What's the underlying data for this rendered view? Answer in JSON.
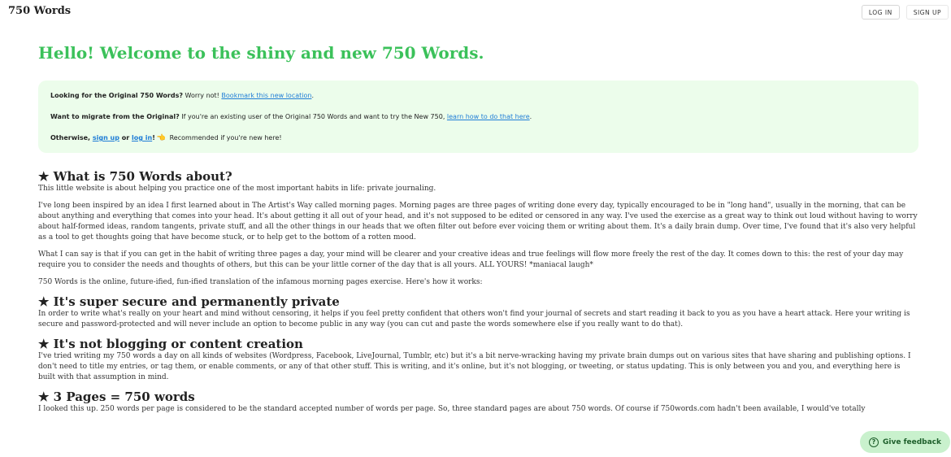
{
  "header": {
    "brand": "750 Words",
    "login_label": "LOG IN",
    "signup_label": "SIGN UP"
  },
  "hero": {
    "title": "Hello! Welcome to the shiny and new 750 Words."
  },
  "notice": {
    "line1_bold": "Looking for the Original 750 Words?",
    "line1_text": " Worry not! ",
    "line1_link": "Bookmark this new location",
    "line1_end": ".",
    "line2_bold": "Want to migrate from the Original?",
    "line2_text": " If you're an existing user of the Original 750 Words and want to try the New 750, ",
    "line2_link": "learn how to do that here",
    "line2_end": ".",
    "line3_bold_a": "Otherwise, ",
    "line3_link_signup": "sign up",
    "line3_bold_or": " or ",
    "line3_link_login": "log in",
    "line3_bang": "!",
    "line3_hand": "👈",
    "line3_text": " Recommended if you're new here!"
  },
  "sections": {
    "about_title": "★ What is 750 Words about?",
    "about_p1": "This little website is about helping you practice one of the most important habits in life: private journaling.",
    "about_p2": "I've long been inspired by an idea I first learned about in The Artist's Way called morning pages. Morning pages are three pages of writing done every day, typically encouraged to be in \"long hand\", usually in the morning, that can be about anything and everything that comes into your head. It's about getting it all out of your head, and it's not supposed to be edited or censored in any way. I've used the exercise as a great way to think out loud without having to worry about half-formed ideas, random tangents, private stuff, and all the other things in our heads that we often filter out before ever voicing them or writing about them. It's a daily brain dump. Over time, I've found that it's also very helpful as a tool to get thoughts going that have become stuck, or to help get to the bottom of a rotten mood.",
    "about_p3": "What I can say is that if you can get in the habit of writing three pages a day, your mind will be clearer and your creative ideas and true feelings will flow more freely the rest of the day. It comes down to this: the rest of your day may require you to consider the needs and thoughts of others, but this can be your little corner of the day that is all yours. ALL YOURS! *maniacal laugh*",
    "about_p4": "750 Words is the online, future-ified, fun-ified translation of the infamous morning pages exercise. Here's how it works:",
    "private_title": "★ It's super secure and permanently private",
    "private_p": "In order to write what's really on your heart and mind without censoring, it helps if you feel pretty confident that others won't find your journal of secrets and start reading it back to you as you have a heart attack. Here your writing is secure and password-protected and will never include an option to become public in any way (you can cut and paste the words somewhere else if you really want to do that).",
    "blog_title": "★ It's not blogging or content creation",
    "blog_p": "I've tried writing my 750 words a day on all kinds of websites (Wordpress, Facebook, LiveJournal, Tumblr, etc) but it's a bit nerve-wracking having my private brain dumps out on various sites that have sharing and publishing options. I don't need to title my entries, or tag them, or enable comments, or any of that other stuff. This is writing, and it's online, but it's not blogging, or tweeting, or status updating. This is only between you and you, and everything here is built with that assumption in mind.",
    "pages_title": "★ 3 Pages = 750 words",
    "pages_p": "I looked this up. 250 words per page is considered to be the standard accepted number of words per page. So, three standard pages are about 750 words. Of course if 750words.com hadn't been available, I would've totally"
  },
  "feedback": {
    "icon": "question-circle-icon",
    "label": "Give feedback"
  }
}
